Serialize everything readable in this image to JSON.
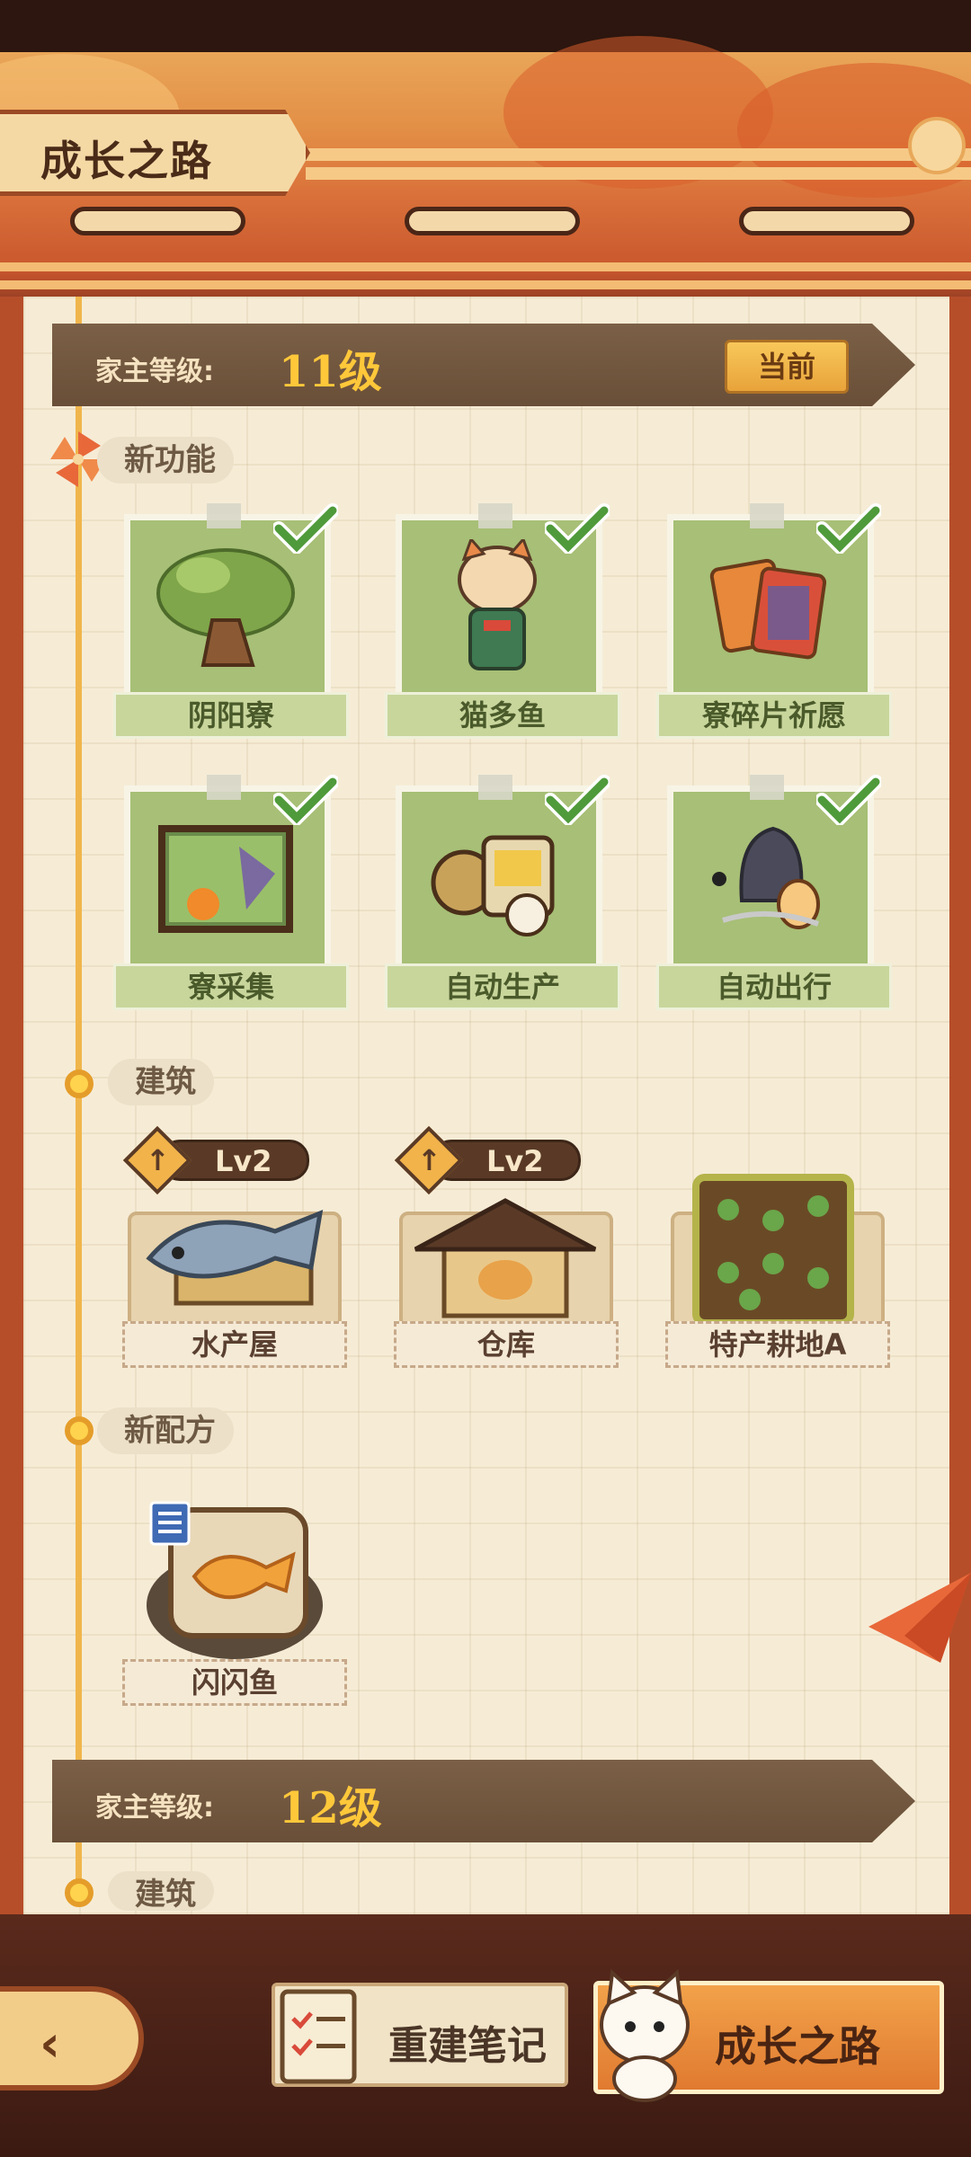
{
  "header": {
    "title": "成长之路"
  },
  "levels": [
    {
      "label": "家主等级:",
      "value": "11级",
      "badge": "当前"
    },
    {
      "label": "家主等级:",
      "value": "12级"
    }
  ],
  "sections": {
    "features": "新功能",
    "buildings": "建筑",
    "recipes": "新配方",
    "next_buildings": "建筑"
  },
  "features": [
    {
      "name": "阴阳寮",
      "icon": "tree-icon",
      "unlocked": true
    },
    {
      "name": "猫多鱼",
      "icon": "lucky-cat-icon",
      "unlocked": true
    },
    {
      "name": "寮碎片祈愿",
      "icon": "cards-icon",
      "unlocked": true
    },
    {
      "name": "寮采集",
      "icon": "gathering-painting-icon",
      "unlocked": true
    },
    {
      "name": "自动生产",
      "icon": "production-machine-icon",
      "unlocked": true
    },
    {
      "name": "自动出行",
      "icon": "travel-stone-icon",
      "unlocked": true
    }
  ],
  "buildings": [
    {
      "name": "水产屋",
      "level": "Lv2",
      "icon": "fish-house-icon"
    },
    {
      "name": "仓库",
      "level": "Lv2",
      "icon": "warehouse-icon"
    },
    {
      "name": "特产耕地A",
      "level": "",
      "icon": "farmland-icon"
    }
  ],
  "recipes": [
    {
      "name": "闪闪鱼",
      "icon": "golden-fish-icon"
    }
  ],
  "nav": {
    "back_icon": "back-chevron-icon",
    "tab_notes": "重建笔记",
    "tab_growth": "成长之路"
  },
  "colors": {
    "accent": "#e8a33a",
    "card_green": "#a7bf76",
    "check_green": "#4f9a3a"
  }
}
